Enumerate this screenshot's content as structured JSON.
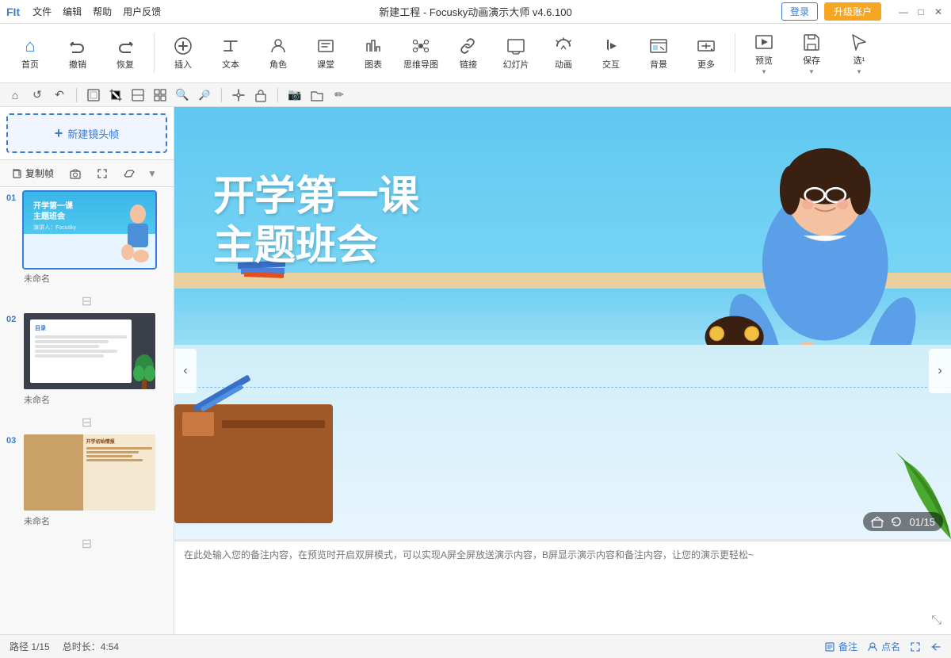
{
  "titlebar": {
    "logo": "FIt",
    "menus": [
      "文件",
      "编辑",
      "帮助",
      "用户反馈"
    ],
    "title": "新建工程 - Focusky动画演示大师 v4.6.100",
    "login_label": "登录",
    "upgrade_label": "升级账户",
    "minimize": "—",
    "maximize": "□",
    "close": "✕"
  },
  "toolbar": {
    "items": [
      {
        "id": "home",
        "label": "首页",
        "icon": "⌂"
      },
      {
        "id": "undo",
        "label": "撤销",
        "icon": "↩"
      },
      {
        "id": "redo",
        "label": "恢复",
        "icon": "↪"
      },
      {
        "id": "insert",
        "label": "插入",
        "icon": "⊕"
      },
      {
        "id": "text",
        "label": "文本",
        "icon": "T"
      },
      {
        "id": "role",
        "label": "角色",
        "icon": "☺"
      },
      {
        "id": "class",
        "label": "课堂",
        "icon": "▣"
      },
      {
        "id": "chart",
        "label": "图表",
        "icon": "⧖"
      },
      {
        "id": "mindmap",
        "label": "思维导图",
        "icon": "⊛"
      },
      {
        "id": "link",
        "label": "链接",
        "icon": "⛓"
      },
      {
        "id": "slide",
        "label": "幻灯片",
        "icon": "▤"
      },
      {
        "id": "animation",
        "label": "动画",
        "icon": "✦"
      },
      {
        "id": "interact",
        "label": "交互",
        "icon": "⊗"
      },
      {
        "id": "background",
        "label": "背景",
        "icon": "▨"
      },
      {
        "id": "more",
        "label": "更多",
        "icon": "⋯"
      },
      {
        "id": "preview",
        "label": "预览",
        "icon": "▶"
      },
      {
        "id": "save",
        "label": "保存",
        "icon": "💾"
      },
      {
        "id": "select",
        "label": "选¹",
        "icon": "↖"
      }
    ]
  },
  "canvas_toolbar": {
    "icons": [
      "⌂",
      "↺",
      "↶",
      "⬜",
      "⬚",
      "🔍",
      "🔎",
      "⊞",
      "⊡",
      "📷",
      "🗂",
      "✏"
    ]
  },
  "sidebar": {
    "new_frame_label": "新建镜头帧",
    "copy_btn": "复制帧",
    "scroll_indicator": "▼",
    "slides": [
      {
        "number": "01",
        "label": "未命名",
        "active": true,
        "type": "slide1"
      },
      {
        "number": "02",
        "label": "未命名",
        "active": false,
        "type": "slide2"
      },
      {
        "number": "03",
        "label": "未命名",
        "active": false,
        "type": "slide3"
      }
    ]
  },
  "main_slide": {
    "title_line1": "开学第一课",
    "title_line2": "主题班会",
    "subtitle": "演讲人：Focusky"
  },
  "page_counter": {
    "current": "01",
    "total": "15",
    "display": "01/15"
  },
  "notes": {
    "placeholder": "在此处输入您的备注内容，在预览时开启双屏模式，可以实现A屏全屏放送演示内容，B屏显示演示内容和备注内容，让您的演示更轻松~"
  },
  "statusbar": {
    "path": "路径 1/15",
    "duration": "总时长：4:54",
    "notes_btn": "备注",
    "points_btn": "点名"
  },
  "colors": {
    "blue_primary": "#3a7bd5",
    "blue_light": "#4db8e8",
    "orange": "#f5a623",
    "bg_canvas": "#4db8e8"
  }
}
